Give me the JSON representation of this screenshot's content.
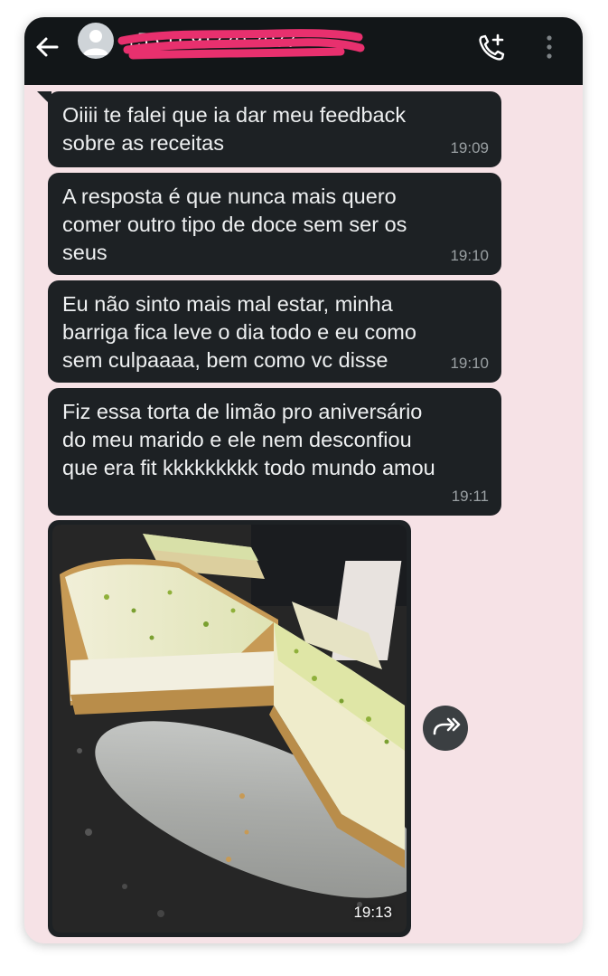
{
  "header": {
    "contact": "+55 11 91770-7077",
    "back_icon": "arrow-left-icon",
    "call_icon": "phone-plus-icon",
    "menu_icon": "more-vertical-icon"
  },
  "messages": [
    {
      "text": "Oiiii te falei que ia dar meu feedback\nsobre as receitas",
      "time": "19:09"
    },
    {
      "text": "A resposta é que nunca mais quero\ncomer outro tipo de doce sem ser os\nseus",
      "time": "19:10"
    },
    {
      "text": "Eu não sinto mais mal estar, minha\nbarriga fica leve o dia todo e eu como\nsem culpaaaa, bem como vc disse",
      "time": "19:10"
    },
    {
      "text": "Fiz essa torta de limão pro aniversário\ndo meu marido e ele nem desconfiou\nque era fit kkkkkkkkk todo mundo amou",
      "time": "19:11"
    }
  ],
  "photo_message": {
    "time": "19:13"
  },
  "colors": {
    "chat_background": "#f6e2e6",
    "bubble": "#1d2124",
    "topbar": "#121618",
    "scribble": "#e8306e"
  }
}
